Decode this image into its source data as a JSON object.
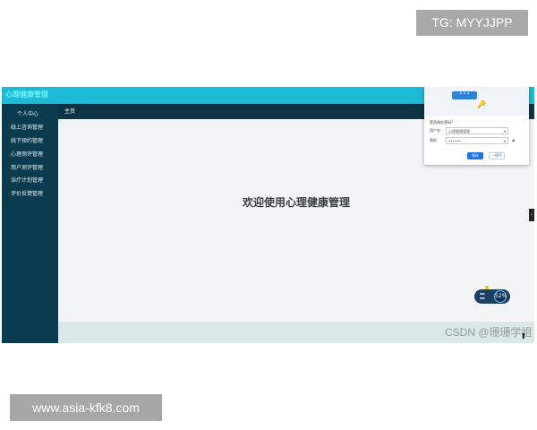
{
  "watermarks": {
    "top_right": "TG: MYYJJPP",
    "bottom_left": "www.asia-kfk8.com",
    "csdn": "CSDN @珊珊学姐"
  },
  "app": {
    "title": "心理健康管理",
    "top_icons": [
      "expand-icon",
      "user-icon"
    ],
    "breadcrumb": "主页",
    "welcome": "欢迎使用心理健康管理"
  },
  "sidebar": {
    "items": [
      {
        "label": "个人中心"
      },
      {
        "label": "线上咨询管理"
      },
      {
        "label": "线下预约管理"
      },
      {
        "label": "心理测评管理"
      },
      {
        "label": "用户测评管理"
      },
      {
        "label": "治疗计划管理"
      },
      {
        "label": "评价反馈管理"
      }
    ]
  },
  "password_popup": {
    "banner": "* * *",
    "title": "是否保存密码?",
    "username_label": "用户名",
    "username_value": "心理健康管理",
    "password_label": "密码",
    "password_value": "••••••",
    "save_label": "保存",
    "never_label": "一律不"
  },
  "speed_widget": {
    "value": "52%"
  },
  "colors": {
    "topbar": "#1cbad6",
    "sidebar": "#0b3b4e",
    "subbar": "#0e3346",
    "main_bg": "#f3f4f5",
    "footer": "#dbe9e6"
  }
}
